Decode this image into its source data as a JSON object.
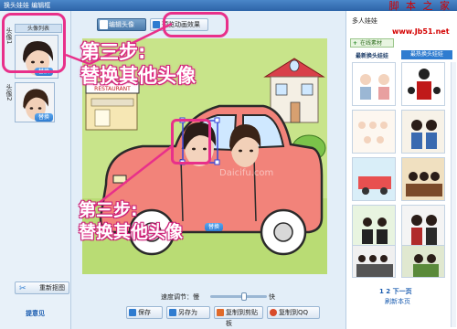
{
  "titlebar": {
    "title": "换头娃娃 编辑框",
    "watermark": "脚 本 之 家"
  },
  "left_panel": {
    "list_tab": "头像列表",
    "faces": [
      {
        "label": "头像1",
        "replace": "替换"
      },
      {
        "label": "头像2",
        "replace": "替换"
      }
    ],
    "rescan_label": "重新抠图",
    "feedback_label": "提意见"
  },
  "toolbar": {
    "edit_label": "编辑头像",
    "preview_label": "预览动画效果"
  },
  "annotation": {
    "line1": "第三步:",
    "line2": "替换其他头像"
  },
  "canvas": {
    "scene_sign": "RESTAURANT",
    "replace_label": "替换",
    "watermark": "Daicifu.com"
  },
  "speed": {
    "label": "速度调节：慢",
    "fast": "快",
    "value": 0.6
  },
  "bottom_buttons": [
    {
      "label": "保存"
    },
    {
      "label": "另存为"
    },
    {
      "label": "复制到剪贴板"
    },
    {
      "label": "复制到QQ"
    }
  ],
  "right_panel": {
    "title": "多人娃娃",
    "watermark": "www.Jb51.net",
    "source_tab": "在线素材",
    "tab_new": "最新换头娃娃",
    "tab_hot": "最热换头娃娃",
    "pager": "1 2 下一页",
    "refresh": "刷新本页"
  },
  "colors": {
    "accent": "#e8308a",
    "canvas_bg": "#c8e48a",
    "car": "#f2837a",
    "brand_blue": "#2f7cd0"
  }
}
